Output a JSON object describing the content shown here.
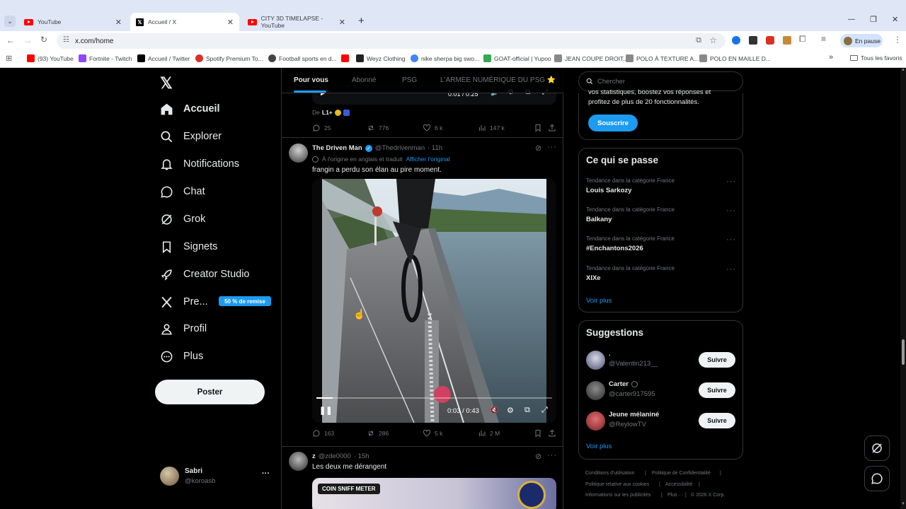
{
  "browser": {
    "tabs": [
      {
        "title": "YouTube"
      },
      {
        "title": "Accueil / X"
      },
      {
        "title": "CITY 3D TIMELAPSE - YouTube"
      }
    ],
    "new_tab": "+",
    "url": "x.com/home",
    "profile_status": "En pause",
    "bookmarks": [
      "(93) YouTube",
      "Fortnite - Twitch",
      "Accueil / Twitter",
      "Spotify Premium To...",
      "Football sports en d...",
      "Weyz Clothing",
      "nike sherpa big swo...",
      "GOAT-official | Yupoo",
      "JEAN COUPE DROIT...",
      "POLO À TEXTURE A...",
      "POLO EN MAILLE D...",
      "Tous les favoris"
    ],
    "bookmarks_overflow": "»"
  },
  "sidebar": {
    "items": [
      {
        "label": "Accueil",
        "icon": "home-icon"
      },
      {
        "label": "Explorer",
        "icon": "search-icon"
      },
      {
        "label": "Notifications",
        "icon": "bell-icon"
      },
      {
        "label": "Chat",
        "icon": "chat-icon"
      },
      {
        "label": "Grok",
        "icon": "grok-icon"
      },
      {
        "label": "Signets",
        "icon": "bookmark-icon"
      },
      {
        "label": "Creator Studio",
        "icon": "rocket-icon"
      },
      {
        "label": "Pre...",
        "icon": "x-logo-icon"
      },
      {
        "label": "Profil",
        "icon": "user-icon"
      },
      {
        "label": "Plus",
        "icon": "more-circle-icon"
      }
    ],
    "premium_badge": "50 % de remise",
    "post_button": "Poster",
    "account": {
      "name": "Sabri",
      "handle": "@koroasb",
      "more": "···"
    }
  },
  "feed": {
    "tabs": [
      "Pour vous",
      "Abonné",
      "PSG",
      "L'ARMEE NUMÉRIQUE DU PSG ⭐"
    ],
    "prev_post": {
      "video_time": "0:01 / 0:25",
      "from_label": "De",
      "from_name": "L1+",
      "stats": {
        "replies": "25",
        "reposts": "776",
        "likes": "6 k",
        "views": "147 k"
      }
    },
    "post": {
      "name": "The Driven Man",
      "handle": "@Thedrivenman",
      "time": "· 11h",
      "translated_note": "À l'origine en anglais et traduit",
      "show_original": "Afficher l'original",
      "text": "frangin a perdu son élan au pire moment.",
      "video_time": "0:03 / 0:43",
      "video_progress": 0.07,
      "stats": {
        "replies": "163",
        "reposts": "286",
        "likes": "5 k",
        "views": "2 M"
      }
    },
    "next_post": {
      "name": "z",
      "handle": "@zde0000",
      "time": "· 15h",
      "text": "Les deux me dérangent",
      "media_caption": "COIN SNIFF METER"
    }
  },
  "right": {
    "search_placeholder": "Chercher",
    "premium_text_1": "vos statistiques, boostez vos réponses et",
    "premium_text_2": "profitez de plus de 20 fonctionnalités.",
    "subscribe": "Souscrire",
    "trends_title": "Ce qui se passe",
    "trends": [
      {
        "context": "Tendance dans la catégorie France",
        "name": "Louis Sarkozy"
      },
      {
        "context": "Tendance dans la catégorie France",
        "name": "Balkany"
      },
      {
        "context": "Tendance dans la catégorie France",
        "name": "#Enchantons2026"
      },
      {
        "context": "Tendance dans la catégorie France",
        "name": "XIXe"
      }
    ],
    "trends_more": "Voir plus",
    "suggestions_title": "Suggestions",
    "suggestions": [
      {
        "name": ".",
        "handle": "@Valentin213__",
        "button": "Suivre"
      },
      {
        "name": "Carter",
        "handle": "@carter917595",
        "button": "Suivre"
      },
      {
        "name": "Jeune mélaniné",
        "handle": "@ReylowTV",
        "button": "Suivre"
      }
    ],
    "suggestions_more": "Voir plus",
    "footer": [
      "Conditions d'utilisation",
      "Politique de Confidentialité",
      "Politique relative aux cookies",
      "Accessibilité",
      "Informations sur les publicités",
      "Plus ···",
      "© 2026 X Corp."
    ]
  },
  "colors": {
    "accent": "#1d9bf0",
    "background": "#000000",
    "border": "#2f3336",
    "muted": "#71767b"
  }
}
